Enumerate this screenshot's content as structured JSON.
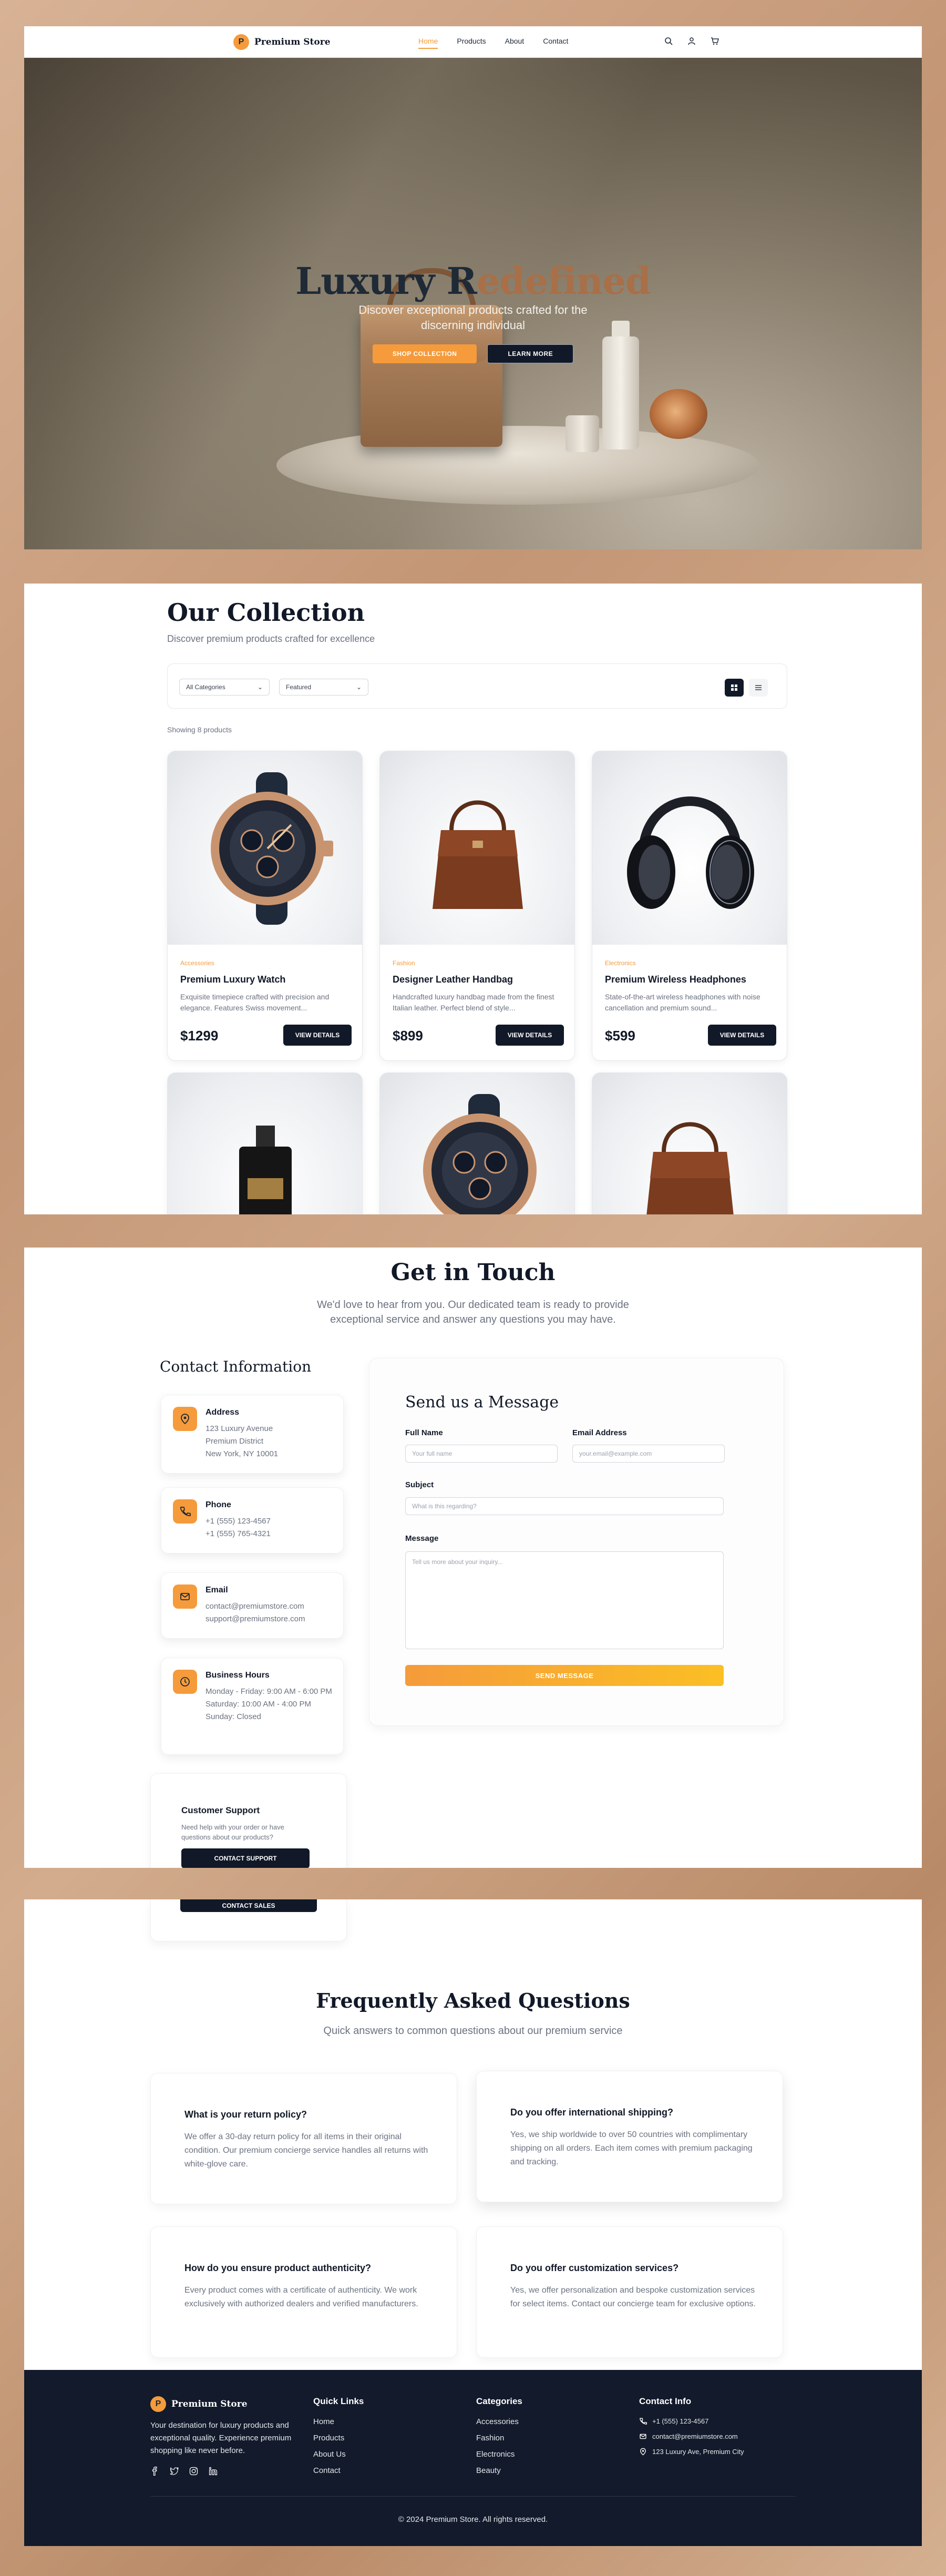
{
  "brand": {
    "mark": "P",
    "name": "Premium Store"
  },
  "nav": {
    "links": [
      {
        "label": "Home",
        "active": true
      },
      {
        "label": "Products",
        "active": false
      },
      {
        "label": "About",
        "active": false
      },
      {
        "label": "Contact",
        "active": false
      }
    ],
    "icons": [
      "search-icon",
      "user-icon",
      "cart-icon"
    ]
  },
  "hero": {
    "title_main": "Luxury R",
    "title_accent": "edefined",
    "subtitle": "Discover exceptional products crafted for the discerning individual",
    "primary_button": "SHOP COLLECTION",
    "secondary_button": "LEARN MORE"
  },
  "collection": {
    "title": "Our Collection",
    "subtitle": "Discover premium products crafted for excellence",
    "filter_category": "All Categories",
    "filter_sort": "Featured",
    "showing_text": "Showing 8 products",
    "view_button": "VIEW DETAILS",
    "products": [
      {
        "category": "Accessories",
        "name": "Premium Luxury Watch",
        "description": "Exquisite timepiece crafted with precision and elegance. Features Swiss movement...",
        "price": "$1299",
        "image": "watch"
      },
      {
        "category": "Fashion",
        "name": "Designer Leather Handbag",
        "description": "Handcrafted luxury handbag made from the finest Italian leather. Perfect blend of style...",
        "price": "$899",
        "image": "handbag"
      },
      {
        "category": "Electronics",
        "name": "Premium Wireless Headphones",
        "description": "State-of-the-art wireless headphones with noise cancellation and premium sound...",
        "price": "$599",
        "image": "headphones"
      },
      {
        "image": "perfume"
      },
      {
        "image": "watch"
      },
      {
        "image": "handbag"
      }
    ]
  },
  "contact": {
    "title": "Get in Touch",
    "subtitle": "We'd love to hear from you. Our dedicated team is ready to provide exceptional service and answer any questions you may have.",
    "info_title": "Contact Information",
    "items": [
      {
        "icon": "map-pin-icon",
        "label": "Address",
        "lines": [
          "123 Luxury Avenue",
          "Premium District",
          "New York, NY 10001"
        ]
      },
      {
        "icon": "phone-icon",
        "label": "Phone",
        "lines": [
          "+1 (555) 123-4567",
          "+1 (555) 765-4321"
        ]
      },
      {
        "icon": "mail-icon",
        "label": "Email",
        "lines": [
          "contact@premiumstore.com",
          "support@premiumstore.com"
        ]
      },
      {
        "icon": "clock-icon",
        "label": "Business Hours",
        "lines": [
          "Monday - Friday: 9:00 AM - 6:00 PM",
          "Saturday: 10:00 AM - 4:00 PM",
          "Sunday: Closed"
        ]
      }
    ],
    "support": {
      "title": "Customer Support",
      "description": "Need help with your order or have questions about our products?",
      "button": "CONTACT SUPPORT",
      "sales_button": "CONTACT SALES"
    },
    "form": {
      "title": "Send us a Message",
      "name_label": "Full Name",
      "name_placeholder": "Your full name",
      "email_label": "Email Address",
      "email_placeholder": "your.email@example.com",
      "subject_label": "Subject",
      "subject_placeholder": "What is this regarding?",
      "message_label": "Message",
      "message_placeholder": "Tell us more about your inquiry...",
      "submit": "SEND MESSAGE"
    }
  },
  "faq": {
    "title": "Frequently Asked Questions",
    "subtitle": "Quick answers to common questions about our premium service",
    "items": [
      {
        "q": "What is your return policy?",
        "a": "We offer a 30-day return policy for all items in their original condition. Our premium concierge service handles all returns with white-glove care."
      },
      {
        "q": "Do you offer international shipping?",
        "a": "Yes, we ship worldwide to over 50 countries with complimentary shipping on all orders. Each item comes with premium packaging and tracking."
      },
      {
        "q": "How do you ensure product authenticity?",
        "a": "Every product comes with a certificate of authenticity. We work exclusively with authorized dealers and verified manufacturers."
      },
      {
        "q": "Do you offer customization services?",
        "a": "Yes, we offer personalization and bespoke customization services for select items. Contact our concierge team for exclusive options."
      }
    ]
  },
  "footer": {
    "about": "Your destination for luxury products and exceptional quality. Experience premium shopping like never before.",
    "social_icons": [
      "facebook-icon",
      "twitter-icon",
      "instagram-icon",
      "linkedin-icon"
    ],
    "quick_links_title": "Quick Links",
    "quick_links": [
      "Home",
      "Products",
      "About Us",
      "Contact"
    ],
    "categories_title": "Categories",
    "categories": [
      "Accessories",
      "Fashion",
      "Electronics",
      "Beauty"
    ],
    "contact_title": "Contact Info",
    "contact_phone": "+1 (555) 123-4567",
    "contact_email": "contact@premiumstore.com",
    "contact_address": "123 Luxury Ave, Premium City",
    "copyright": "© 2024 Premium Store. All rights reserved."
  },
  "colors": {
    "accent": "#f59b3b",
    "dark": "#111827",
    "footer_bg": "#121a2b",
    "muted": "#6b7280"
  }
}
